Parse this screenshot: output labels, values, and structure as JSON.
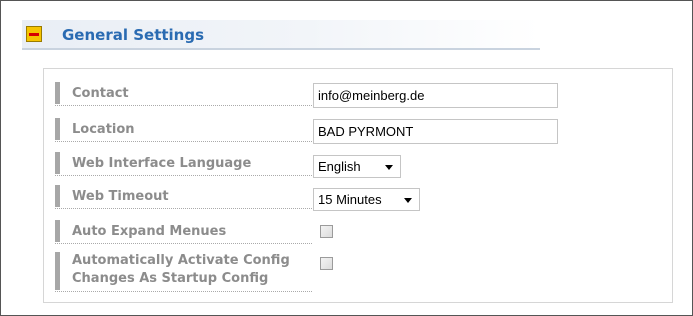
{
  "section": {
    "title": "General Settings",
    "collapse_icon": "minus-icon"
  },
  "fields": {
    "contact": {
      "label": "Contact",
      "value": "info@meinberg.de"
    },
    "location": {
      "label": "Location",
      "value": "BAD PYRMONT"
    },
    "language": {
      "label": "Web Interface Language",
      "value": "English"
    },
    "timeout": {
      "label": "Web Timeout",
      "value": "15 Minutes"
    },
    "auto_expand": {
      "label": "Auto Expand Menues",
      "checked": false
    },
    "auto_activate": {
      "label_line1": "Automatically Activate Config",
      "label_line2": "Changes As Startup Config",
      "checked": false
    }
  },
  "colors": {
    "title": "#2a6bb2",
    "label": "#8c8c8c",
    "collapse_icon_bg": "#f6c400",
    "collapse_icon_bar": "#d60000"
  }
}
